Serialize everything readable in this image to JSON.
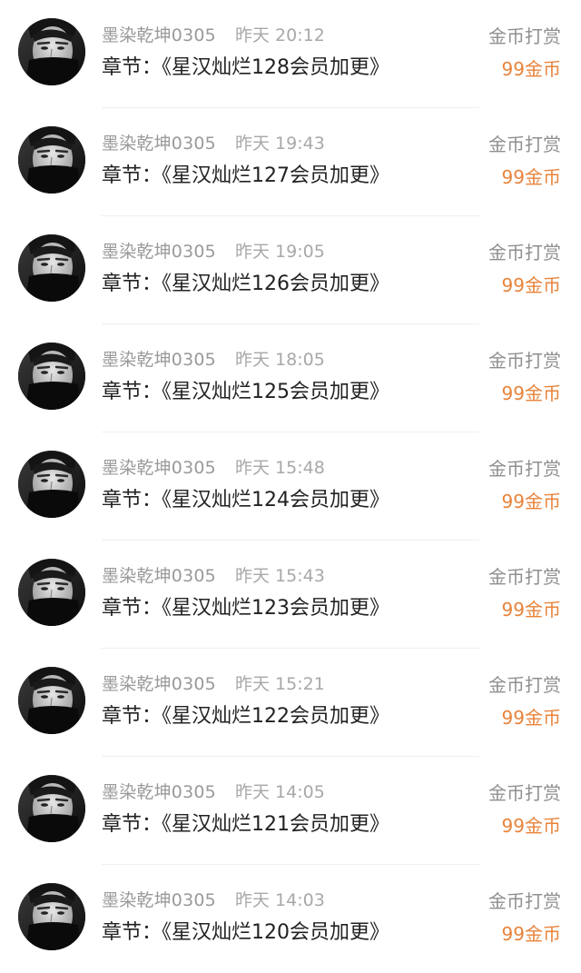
{
  "records": [
    {
      "user": "墨染乾坤0305",
      "time": "昨天 20:12",
      "chapter": "章节：《星汉灿烂128会员加更》",
      "action": "金币打赏",
      "amount": "99金币"
    },
    {
      "user": "墨染乾坤0305",
      "time": "昨天 19:43",
      "chapter": "章节：《星汉灿烂127会员加更》",
      "action": "金币打赏",
      "amount": "99金币"
    },
    {
      "user": "墨染乾坤0305",
      "time": "昨天 19:05",
      "chapter": "章节：《星汉灿烂126会员加更》",
      "action": "金币打赏",
      "amount": "99金币"
    },
    {
      "user": "墨染乾坤0305",
      "time": "昨天 18:05",
      "chapter": "章节：《星汉灿烂125会员加更》",
      "action": "金币打赏",
      "amount": "99金币"
    },
    {
      "user": "墨染乾坤0305",
      "time": "昨天 15:48",
      "chapter": "章节：《星汉灿烂124会员加更》",
      "action": "金币打赏",
      "amount": "99金币"
    },
    {
      "user": "墨染乾坤0305",
      "time": "昨天 15:43",
      "chapter": "章节：《星汉灿烂123会员加更》",
      "action": "金币打赏",
      "amount": "99金币"
    },
    {
      "user": "墨染乾坤0305",
      "time": "昨天 15:21",
      "chapter": "章节：《星汉灿烂122会员加更》",
      "action": "金币打赏",
      "amount": "99金币"
    },
    {
      "user": "墨染乾坤0305",
      "time": "昨天 14:05",
      "chapter": "章节：《星汉灿烂121会员加更》",
      "action": "金币打赏",
      "amount": "99金币"
    },
    {
      "user": "墨染乾坤0305",
      "time": "昨天 14:03",
      "chapter": "章节：《星汉灿烂120会员加更》",
      "action": "金币打赏",
      "amount": "99金币"
    }
  ],
  "colors": {
    "amount": "#e8833a",
    "meta": "#9a9a9a",
    "title": "#222222"
  }
}
